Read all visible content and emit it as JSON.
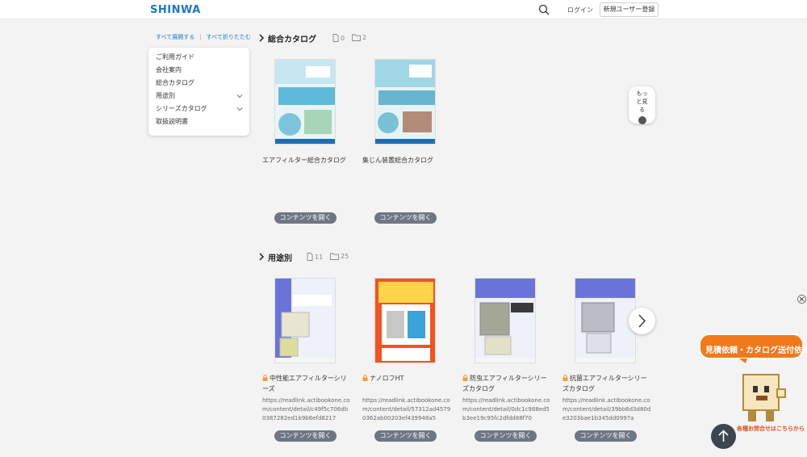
{
  "header": {
    "logo": "SHINWA",
    "login": "ログイン",
    "register": "新規ユーザー登録"
  },
  "sidebar": {
    "expand_all": "すべて展開する",
    "separator": "|",
    "collapse_all": "すべて折りたたむ",
    "items": [
      {
        "label": "ご利用ガイド"
      },
      {
        "label": "会社案内"
      },
      {
        "label": "総合カタログ"
      },
      {
        "label": "用途別"
      },
      {
        "label": "シリーズカタログ"
      },
      {
        "label": "取扱説明書"
      }
    ]
  },
  "sections": [
    {
      "title": "総合カタログ",
      "doc_count": "0",
      "folder_count": "2",
      "cards": [
        {
          "title": "エアフィルター総合カタログ",
          "button": "コンテンツを開く"
        },
        {
          "title": "集じん装置総合カタログ",
          "button": "コンテンツを開く"
        }
      ]
    },
    {
      "title": "用途別",
      "doc_count": "11",
      "folder_count": "25",
      "cards": [
        {
          "title": "中性能エアフィルターシリーズ",
          "url": "https://readlink.actibookone.com/content/detail/c49f5c706db0387282ed1b9b6efd8217",
          "button": "コンテンツを開く"
        },
        {
          "title": "ナノロフHT",
          "url": "https://readlink.actibookone.com/content/detail/57312ad45790362ab00203ef439948a5",
          "button": "コンテンツを開く"
        },
        {
          "title": "防虫エアフィルターシリーズカタログ",
          "url": "https://readlink.actibookone.com/content/detail/0dc1c988ed5b3ee19c95fc2dfdd88f70",
          "button": "コンテンツを開く"
        },
        {
          "title": "抗菌エアフィルターシリーズカタログ",
          "url": "https://readlink.actibookone.com/content/detail/39bb6d3d80de3203bae1b345dd0997a",
          "button": "コンテンツを開く"
        }
      ]
    }
  ],
  "more_button": "もっと見る",
  "banner": {
    "text": "見積依頼・カタログ送付依頼",
    "contact": "各種お問合せはこちらから"
  },
  "colors": {
    "accent": "#1a78c9",
    "button": "#6f7683",
    "banner": "#f07a1a"
  }
}
